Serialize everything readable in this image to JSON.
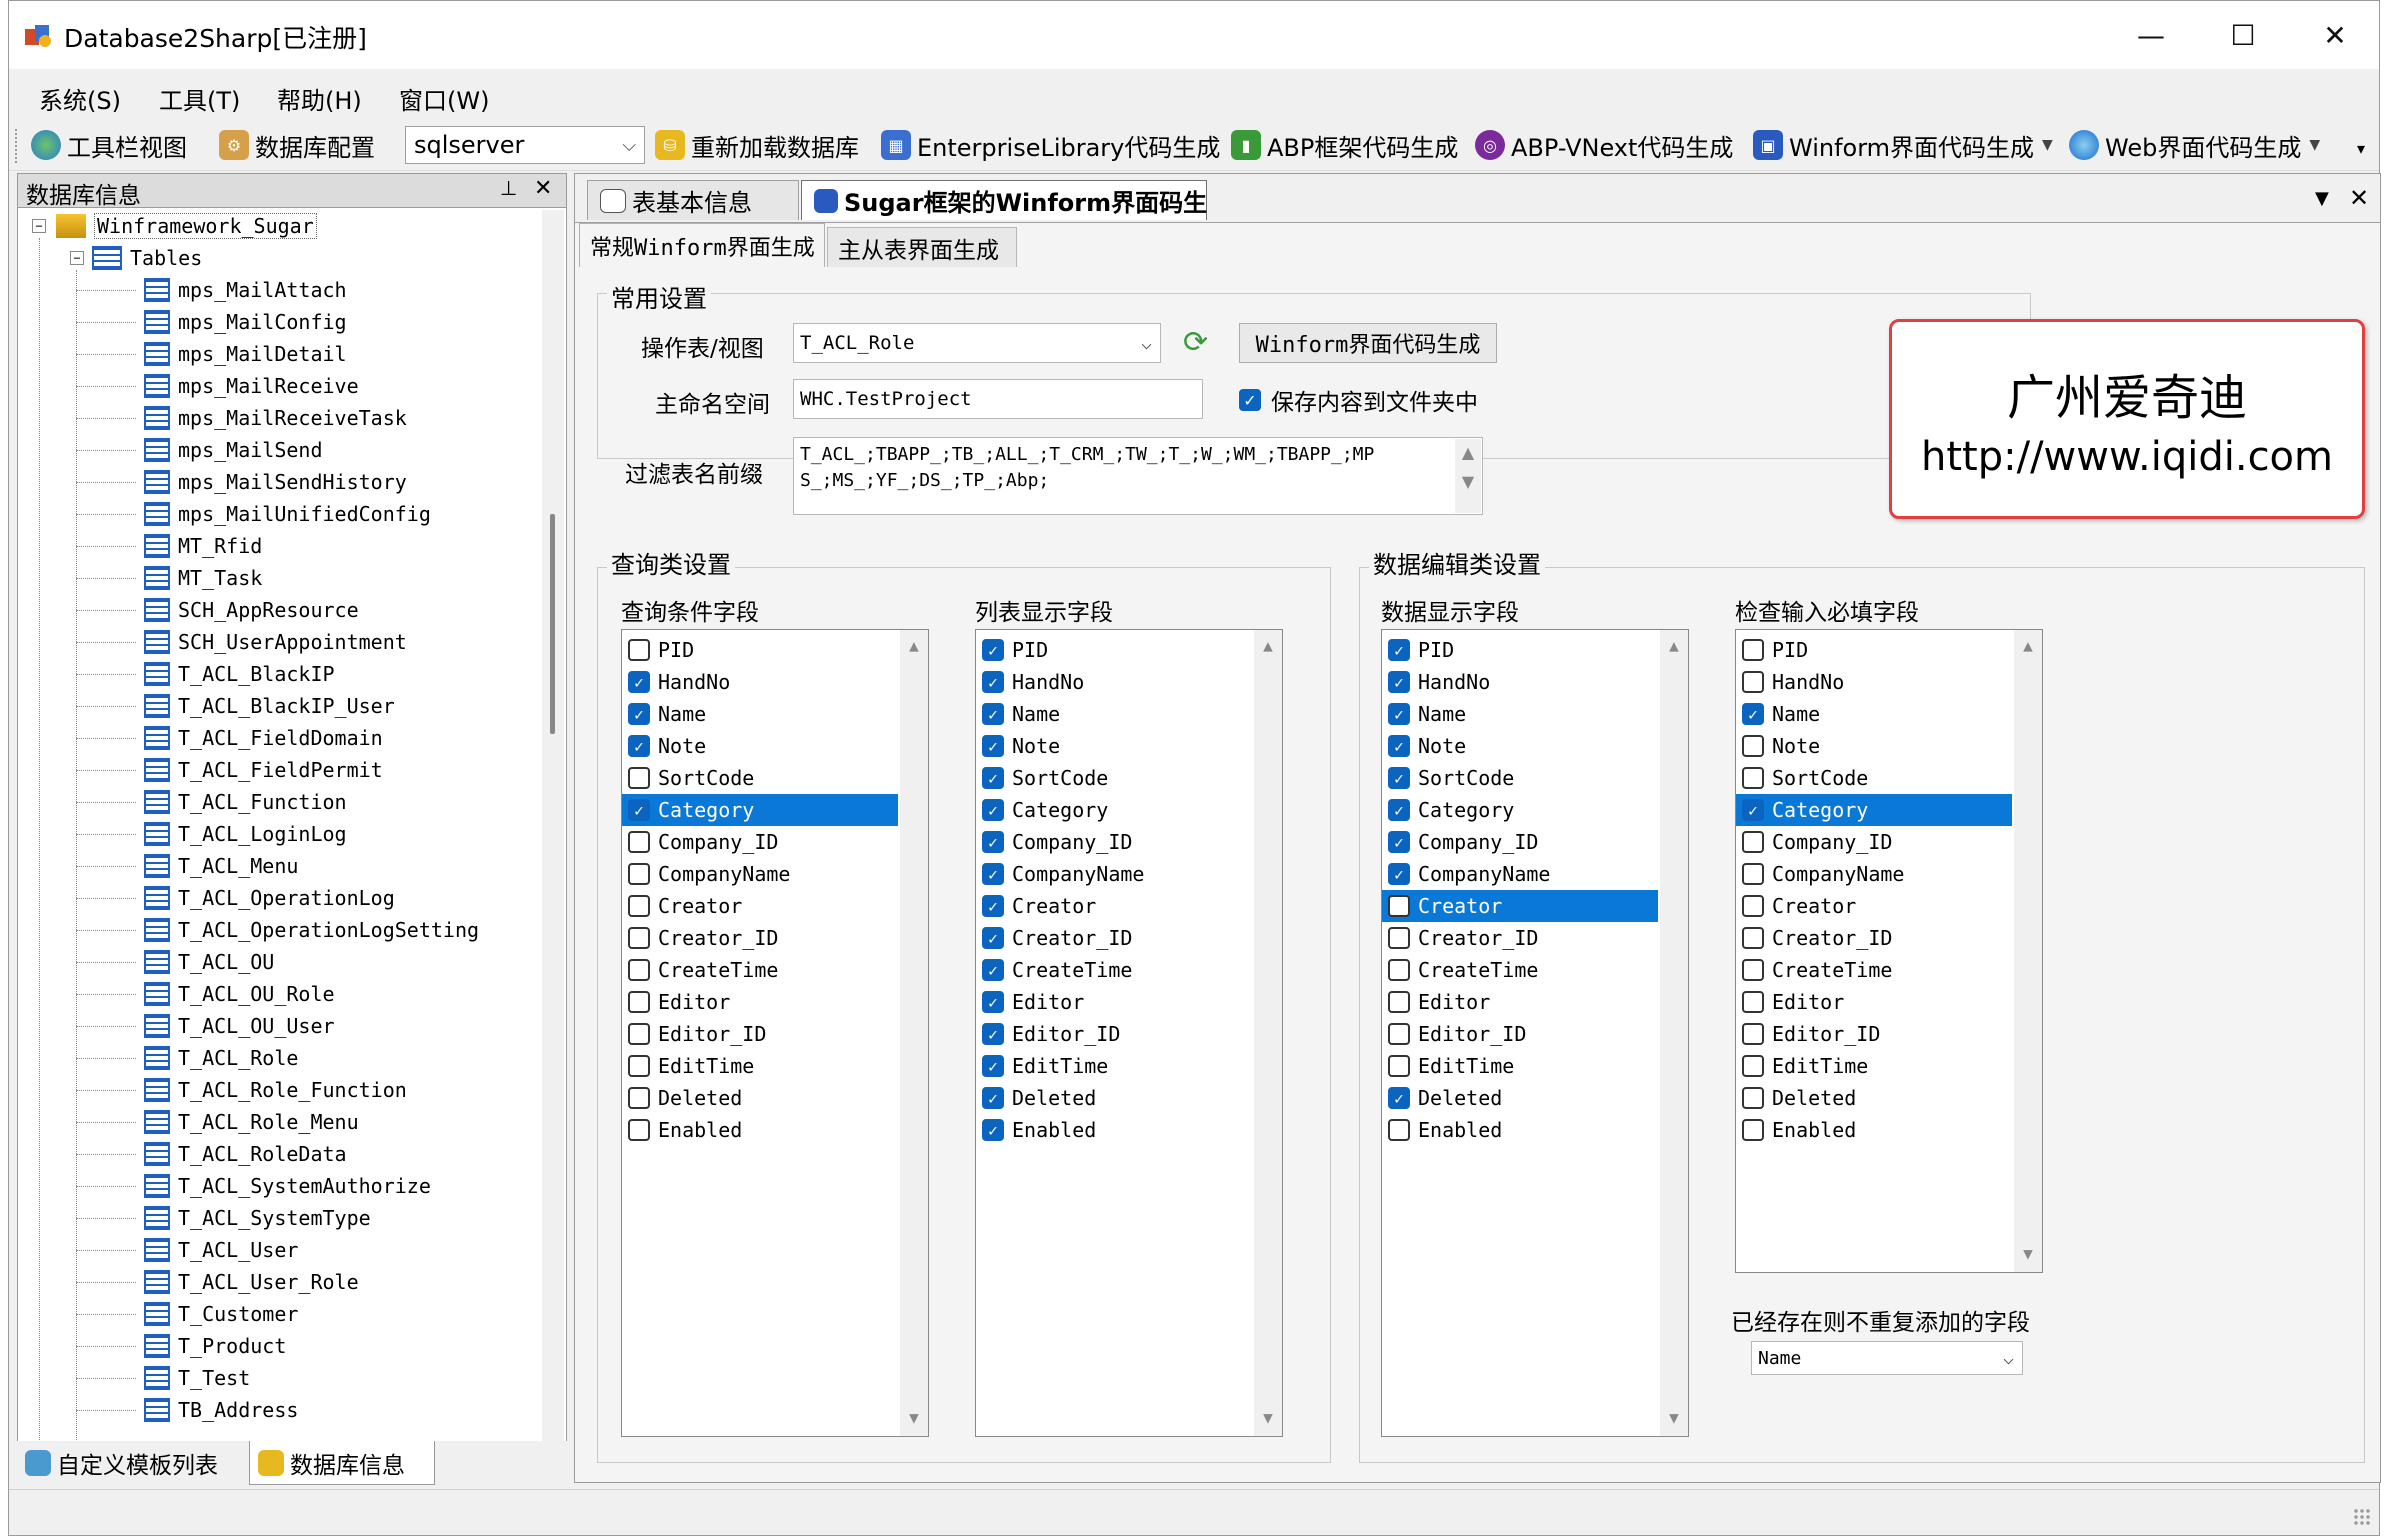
{
  "window": {
    "title": "Database2Sharp[已注册]",
    "minimize_glyph": "—",
    "maximize_glyph": "☐",
    "close_glyph": "✕"
  },
  "menu": [
    "系统(S)",
    "工具(T)",
    "帮助(H)",
    "窗口(W)"
  ],
  "toolbar": {
    "toolbar_view": "工具栏视图",
    "db_config": "数据库配置",
    "db_type": "sqlserver",
    "reload": "重新加载数据库",
    "enterprise": "EnterpriseLibrary代码生成",
    "abp": "ABP框架代码生成",
    "abp_vnext": "ABP-VNext代码生成",
    "winform_ui": "Winform界面代码生成",
    "web_ui": "Web界面代码生成"
  },
  "left_panel": {
    "title": "数据库信息",
    "pin_glyph": "⊥",
    "close_glyph": "✕",
    "database": "Winframework_Sugar",
    "tables_node": "Tables",
    "tables": [
      "mps_MailAttach",
      "mps_MailConfig",
      "mps_MailDetail",
      "mps_MailReceive",
      "mps_MailReceiveTask",
      "mps_MailSend",
      "mps_MailSendHistory",
      "mps_MailUnifiedConfig",
      "MT_Rfid",
      "MT_Task",
      "SCH_AppResource",
      "SCH_UserAppointment",
      "T_ACL_BlackIP",
      "T_ACL_BlackIP_User",
      "T_ACL_FieldDomain",
      "T_ACL_FieldPermit",
      "T_ACL_Function",
      "T_ACL_LoginLog",
      "T_ACL_Menu",
      "T_ACL_OperationLog",
      "T_ACL_OperationLogSetting",
      "T_ACL_OU",
      "T_ACL_OU_Role",
      "T_ACL_OU_User",
      "T_ACL_Role",
      "T_ACL_Role_Function",
      "T_ACL_Role_Menu",
      "T_ACL_RoleData",
      "T_ACL_SystemAuthorize",
      "T_ACL_SystemType",
      "T_ACL_User",
      "T_ACL_User_Role",
      "T_Customer",
      "T_Product",
      "T_Test",
      "TB_Address"
    ],
    "bottom_tabs": [
      "自定义模板列表",
      "数据库信息"
    ]
  },
  "doc_tabs": [
    "表基本信息",
    "Sugar框架的Winform界面码生"
  ],
  "doc_tab_menu_glyph": "▼",
  "doc_tab_close_glyph": "✕",
  "sub_tabs": [
    "常规Winform界面生成",
    "主从表界面生成"
  ],
  "common": {
    "group_title": "常用设置",
    "table_label": "操作表/视图",
    "table_value": "T_ACL_Role",
    "gen_button": "Winform界面代码生成",
    "namespace_label": "主命名空间",
    "namespace_value": "WHC.TestProject",
    "save_to_folder": "保存内容到文件夹中",
    "save_to_folder_checked": true,
    "filter_label": "过滤表名前缀",
    "filter_line1": "T_ACL_;TBAPP_;TB_;ALL_;T_CRM_;TW_;T_;W_;WM_;TBAPP_;MP",
    "filter_line2": "S_;MS_;YF_;DS_;TP_;Abp;"
  },
  "watermark": {
    "line1": "广州爱奇迪",
    "line2": "http://www.iqidi.com"
  },
  "query_group": {
    "title": "查询类设置",
    "cond_title": "查询条件字段",
    "list_title": "列表显示字段"
  },
  "edit_group": {
    "title": "数据编辑类设置",
    "display_title": "数据显示字段",
    "required_title": "检查输入必填字段",
    "existing_title": "已经存在则不重复添加的字段",
    "existing_value": "Name"
  },
  "fields": [
    "PID",
    "HandNo",
    "Name",
    "Note",
    "SortCode",
    "Category",
    "Company_ID",
    "CompanyName",
    "Creator",
    "Creator_ID",
    "CreateTime",
    "Editor",
    "Editor_ID",
    "EditTime",
    "Deleted",
    "Enabled"
  ],
  "lists": {
    "cond": {
      "checked": [
        false,
        true,
        true,
        true,
        false,
        true,
        false,
        false,
        false,
        false,
        false,
        false,
        false,
        false,
        false,
        false
      ],
      "selected": 5
    },
    "list": {
      "checked": [
        true,
        true,
        true,
        true,
        true,
        true,
        true,
        true,
        true,
        true,
        true,
        true,
        true,
        true,
        true,
        true
      ],
      "selected": -1
    },
    "display": {
      "checked": [
        true,
        true,
        true,
        true,
        true,
        true,
        true,
        true,
        false,
        false,
        false,
        false,
        false,
        false,
        true,
        false
      ],
      "selected": 8
    },
    "required": {
      "checked": [
        false,
        false,
        true,
        false,
        false,
        true,
        false,
        false,
        false,
        false,
        false,
        false,
        false,
        false,
        false,
        false
      ],
      "selected": 5
    }
  },
  "colors": {
    "accent": "#0b64c0",
    "selection": "#0a78d7",
    "stamp_border": "#e04040"
  }
}
